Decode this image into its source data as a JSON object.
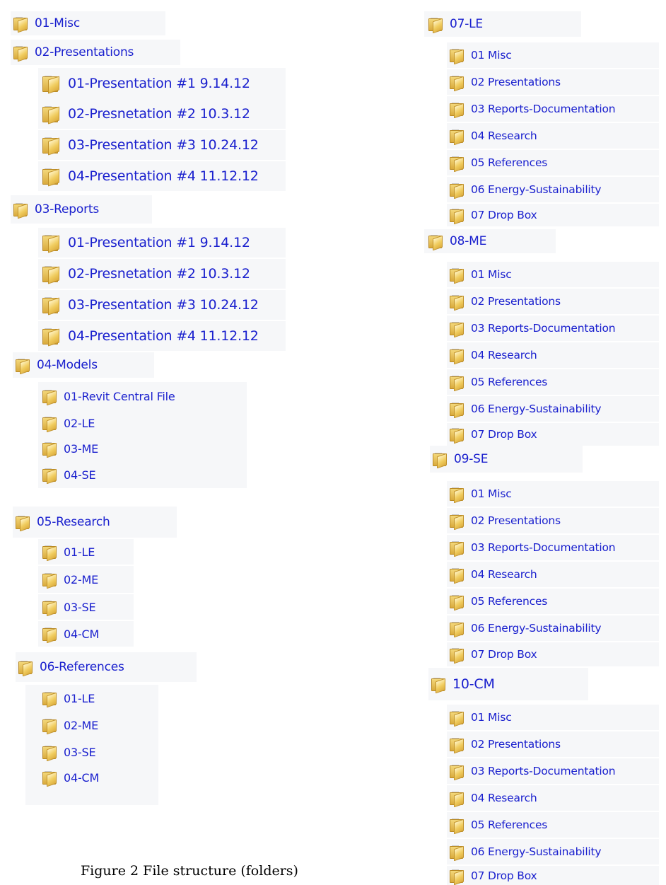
{
  "tree": {
    "f01": "01-Misc",
    "f02": "02-Presentations",
    "f02_1": "01-Presentation #1 9.14.12",
    "f02_2": "02-Presnetation #2 10.3.12",
    "f02_3": "03-Presentation #3 10.24.12",
    "f02_4": "04-Presentation #4 11.12.12",
    "f03": "03-Reports",
    "f03_1": "01-Presentation #1 9.14.12",
    "f03_2": "02-Presnetation #2 10.3.12",
    "f03_3": "03-Presentation #3 10.24.12",
    "f03_4": "04-Presentation #4 11.12.12",
    "f04": "04-Models",
    "f04_1": "01-Revit Central File",
    "f04_2": "02-LE",
    "f04_3": "03-ME",
    "f04_4": "04-SE",
    "f05": "05-Research",
    "f05_1": "01-LE",
    "f05_2": "02-ME",
    "f05_3": "03-SE",
    "f05_4": "04-CM",
    "f06": "06-References",
    "f06_1": "01-LE",
    "f06_2": "02-ME",
    "f06_3": "03-SE",
    "f06_4": "04-CM",
    "f07": "07-LE",
    "f07_1": "01 Misc",
    "f07_2": "02 Presentations",
    "f07_3": "03 Reports-Documentation",
    "f07_4": "04 Research",
    "f07_5": "05 References",
    "f07_6": "06 Energy-Sustainability",
    "f07_7": "07 Drop Box",
    "f08": "08-ME",
    "f08_1": "01 Misc",
    "f08_2": "02 Presentations",
    "f08_3": "03 Reports-Documentation",
    "f08_4": "04 Research",
    "f08_5": "05 References",
    "f08_6": "06 Energy-Sustainability",
    "f08_7": "07 Drop Box",
    "f09": "09-SE",
    "f09_1": "01 Misc",
    "f09_2": "02 Presentations",
    "f09_3": "03 Reports-Documentation",
    "f09_4": "04 Research",
    "f09_5": "05 References",
    "f09_6": "06 Energy-Sustainability",
    "f09_7": "07 Drop Box",
    "f10": "10-CM",
    "f10_1": "01 Misc",
    "f10_2": "02 Presentations",
    "f10_3": "03 Reports-Documentation",
    "f10_4": "04 Research",
    "f10_5": "05 References",
    "f10_6": "06 Energy-Sustainability",
    "f10_7": "07 Drop Box"
  },
  "caption": "Figure 2 File structure (folders)",
  "colors": {
    "folder_text": "#1a20ce",
    "row_bg": "#f6f7f9",
    "folder_fill": "#f0cc5e"
  },
  "icons": {
    "folder": "folder-icon"
  }
}
